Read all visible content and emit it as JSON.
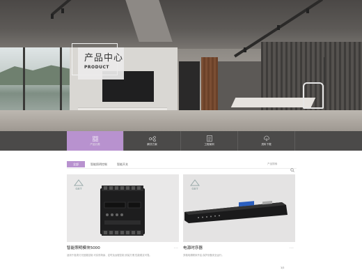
{
  "hero": {
    "title_cn": "产品中心",
    "title_en": "PRODUCT"
  },
  "nav": {
    "items": [
      {
        "label": "产品分类",
        "icon": "grid-icon",
        "active": true
      },
      {
        "label": "解决方案",
        "icon": "network-icon",
        "active": false
      },
      {
        "label": "工程案例",
        "icon": "document-icon",
        "active": false
      },
      {
        "label": "资料下载",
        "icon": "cloud-download-icon",
        "active": false
      }
    ]
  },
  "filter": {
    "tabs": [
      {
        "label": "全部",
        "active": true
      },
      {
        "label": "智能照明控制",
        "active": false
      },
      {
        "label": "智能开关",
        "active": false
      }
    ],
    "search_placeholder": "产品搜索"
  },
  "products": [
    {
      "title": "智能照明模块5000",
      "more": "...",
      "brand": "GET",
      "desc": "适用于各类灯光回路控制,可实现场景、定时及远程控制,安装方便,性能稳定可靠。"
    },
    {
      "title": "电源时序器",
      "more": "...",
      "brand": "GET",
      "desc": "多路电源顺序开启,保护设备安全运行。"
    }
  ],
  "footer": {
    "chip": "1/1"
  },
  "colors": {
    "accent": "#b892cf",
    "nav_bg": "#4b4a49"
  }
}
